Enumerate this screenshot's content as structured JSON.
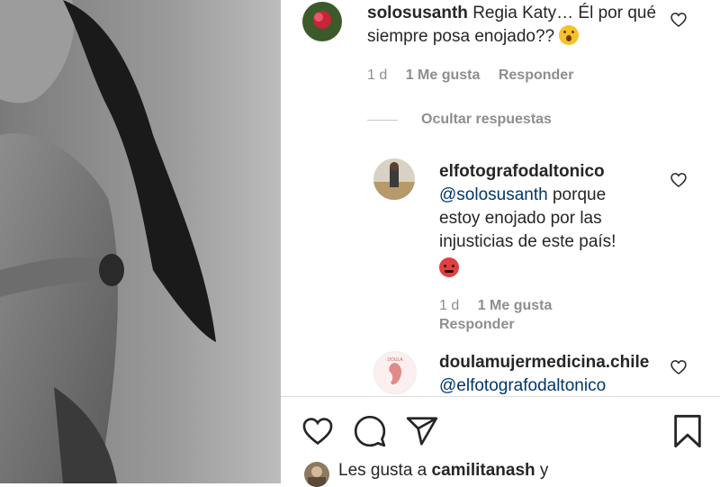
{
  "comments": [
    {
      "username": "solosusanth",
      "text": "Regia Katy… Él por qué siempre posa enojado??",
      "emoji": "hushed-face",
      "age": "1 d",
      "likes": "1 Me gusta",
      "reply": "Responder"
    }
  ],
  "toggle_replies": "Ocultar respuestas",
  "replies": [
    {
      "username": "elfotografodaltonico",
      "mention": "@solosusanth",
      "text": "porque estoy enojado por las injusticias de este país!",
      "emoji": "angry-face",
      "age": "1 d",
      "likes": "1 Me gusta",
      "reply": "Responder"
    },
    {
      "username": "doulamujermedicina.chile",
      "mention": "@elfotografodaltonico"
    }
  ],
  "footer": {
    "likes_prefix": "Les gusta a",
    "likes_user": "camilitanash",
    "likes_suffix": "y"
  },
  "icons": [
    "heart-icon",
    "comment-icon",
    "share-icon",
    "bookmark-icon"
  ]
}
